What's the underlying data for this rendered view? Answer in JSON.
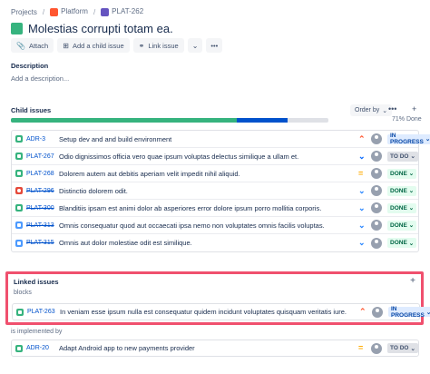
{
  "breadcrumb": {
    "projects": "Projects",
    "project": "Platform",
    "issue": "PLAT-262",
    "sep": "/"
  },
  "issue": {
    "title": "Molestias corrupti totam ea."
  },
  "toolbar": {
    "attach": "Attach",
    "add_child": "Add a child issue",
    "link_issue": "Link issue",
    "more": "•••"
  },
  "description": {
    "heading": "Description",
    "placeholder": "Add a description..."
  },
  "child_issues": {
    "heading": "Child issues",
    "order_by": "Order by",
    "progress_done": 0.71,
    "progress_in_progress": 0.16,
    "progress_label": "71% Done",
    "items": [
      {
        "type": "story",
        "key": "ADR-3",
        "summary": "Setup dev and and build environment",
        "done": false,
        "priority": "highest",
        "status": "IN PROGRESS"
      },
      {
        "type": "story",
        "key": "PLAT-267",
        "summary": "Odio dignissimos officia vero quae ipsum voluptas delectus similique a ullam et.",
        "done": false,
        "priority": "low",
        "status": "TO DO"
      },
      {
        "type": "story",
        "key": "PLAT-268",
        "summary": "Dolorem autem aut debitis aperiam velit impedit nihil aliquid.",
        "done": false,
        "priority": "medium",
        "status": "DONE"
      },
      {
        "type": "bug",
        "key": "PLAT-296",
        "summary": "Distinctio dolorem odit.",
        "done": true,
        "priority": "lowest",
        "status": "DONE"
      },
      {
        "type": "story",
        "key": "PLAT-300",
        "summary": "Blanditiis ipsam est animi dolor ab asperiores error dolore ipsum porro mollitia corporis.",
        "done": true,
        "priority": "lowest",
        "status": "DONE"
      },
      {
        "type": "task",
        "key": "PLAT-313",
        "summary": "Omnis consequatur quod aut occaecati ipsa nemo non voluptates omnis facilis voluptas.",
        "done": true,
        "priority": "lowest",
        "status": "DONE"
      },
      {
        "type": "task",
        "key": "PLAT-315",
        "summary": "Omnis aut dolor molestiae odit est similique.",
        "done": true,
        "priority": "lowest",
        "status": "DONE"
      }
    ]
  },
  "linked_issues": {
    "heading": "Linked issues",
    "blocks_label": "blocks",
    "blocks": {
      "type": "story",
      "key": "PLAT-263",
      "summary": "In veniam esse ipsum nulla est consequatur quidem incidunt voluptates quisquam veritatis iure.",
      "priority": "highest",
      "status": "IN PROGRESS"
    },
    "implemented_label": "is implemented by",
    "implemented": {
      "type": "story",
      "key": "ADR-20",
      "summary": "Adapt Android app to new payments provider",
      "priority": "medium",
      "status": "TO DO"
    }
  },
  "colors": {
    "done": "#36b37e",
    "in_progress": "#0052cc",
    "link_highlight": "#f0506e",
    "accent": "#0052cc"
  }
}
